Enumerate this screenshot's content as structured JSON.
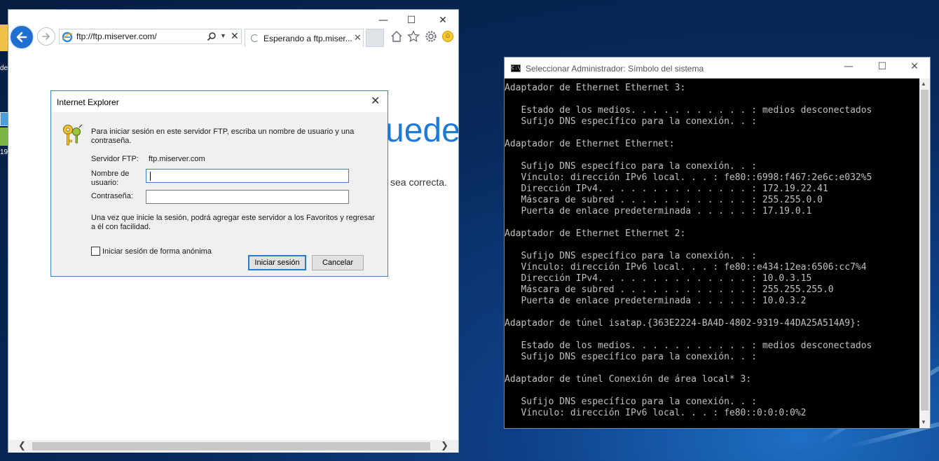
{
  "desktop": {
    "label_top": "de",
    "label_bottom": "19"
  },
  "ie": {
    "caption": {
      "minimize": "—",
      "maximize": "☐",
      "close": "✕"
    },
    "address": "ftp://ftp.miserver.com/",
    "tab_title": "Esperando a ftp.miser...",
    "tab_close": "✕",
    "address_clear": "✕",
    "page_heading_fragment": "uede",
    "page_text_fragment": "sea correcta.",
    "scroll_left": "❮",
    "scroll_right": "❯",
    "icons": [
      "back-arrow-icon",
      "forward-arrow-icon",
      "ie-logo-icon",
      "search-icon",
      "home-icon",
      "favorites-star-icon",
      "settings-gear-icon",
      "feedback-smiley-icon"
    ]
  },
  "dialog": {
    "title": "Internet Explorer",
    "close": "✕",
    "message": "Para iniciar sesión en este servidor FTP, escriba un nombre de usuario y una contraseña.",
    "server_label": "Servidor FTP:",
    "server_value": "ftp.miserver.com",
    "username_label": "Nombre de usuario:",
    "username_value": "",
    "password_label": "Contraseña:",
    "password_value": "",
    "info": "Una vez que inicie la sesión, podrá agregar este servidor a los Favoritos y regresar a él con facilidad.",
    "anonymous_label": "Iniciar sesión de forma anónima",
    "anonymous_checked": false,
    "login_button": "Iniciar sesión",
    "cancel_button": "Cancelar",
    "icon": "keys-icon"
  },
  "cmd": {
    "title": "Seleccionar Administrador: Símbolo del sistema",
    "caption": {
      "minimize": "—",
      "maximize": "☐",
      "close": "✕"
    },
    "lines": [
      "Adaptador de Ethernet Ethernet 3:",
      "",
      "   Estado de los medios. . . . . . . . . . . : medios desconectados",
      "   Sufijo DNS específico para la conexión. . :",
      "",
      "Adaptador de Ethernet Ethernet:",
      "",
      "   Sufijo DNS específico para la conexión. . :",
      "   Vínculo: dirección IPv6 local. . . : fe80::6998:f467:2e6c:e032%5",
      "   Dirección IPv4. . . . . . . . . . . . . . : 172.19.22.41",
      "   Máscara de subred . . . . . . . . . . . . : 255.255.0.0",
      "   Puerta de enlace predeterminada . . . . . : 17.19.0.1",
      "",
      "Adaptador de Ethernet Ethernet 2:",
      "",
      "   Sufijo DNS específico para la conexión. . :",
      "   Vínculo: dirección IPv6 local. . . : fe80::e434:12ea:6506:cc7%4",
      "   Dirección IPv4. . . . . . . . . . . . . . : 10.0.3.15",
      "   Máscara de subred . . . . . . . . . . . . : 255.255.255.0",
      "   Puerta de enlace predeterminada . . . . . : 10.0.3.2",
      "",
      "Adaptador de túnel isatap.{363E2224-BA4D-4802-9319-44DA25A514A9}:",
      "",
      "   Estado de los medios. . . . . . . . . . . : medios desconectados",
      "   Sufijo DNS específico para la conexión. . :",
      "",
      "Adaptador de túnel Conexión de área local* 3:",
      "",
      "   Sufijo DNS específico para la conexión. . :",
      "   Vínculo: dirección IPv6 local. . . : fe80::0:0:0:0%2"
    ]
  }
}
